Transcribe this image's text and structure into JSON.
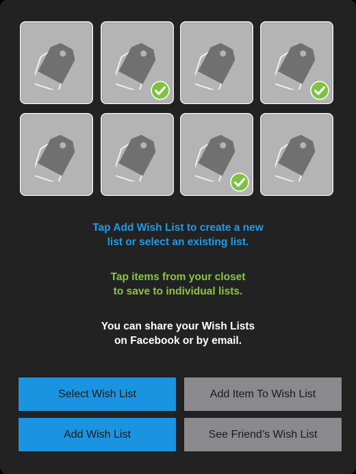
{
  "grid": {
    "tiles": [
      {
        "icon": "tag-icon",
        "checked": false
      },
      {
        "icon": "tag-icon",
        "checked": true
      },
      {
        "icon": "tag-icon",
        "checked": false
      },
      {
        "icon": "tag-icon",
        "checked": true
      },
      {
        "icon": "tag-icon",
        "checked": false
      },
      {
        "icon": "tag-icon",
        "checked": false
      },
      {
        "icon": "tag-icon",
        "checked": true
      },
      {
        "icon": "tag-icon",
        "checked": false
      }
    ]
  },
  "messages": {
    "add_list": "Tap Add Wish List to create a new\nlist or select an existing list.",
    "save_items": "Tap items from your closet\nto save to individual lists.",
    "share": "You can share your Wish Lists\non Facebook or by email."
  },
  "buttons": {
    "select_wish_list": "Select Wish List",
    "add_item_to_wish_list": "Add Item To Wish List",
    "add_wish_list": "Add Wish List",
    "see_friends_wish_list": "See Friend’s Wish List"
  },
  "colors": {
    "background": "#222222",
    "tile": "#b4b4b4",
    "tile_border": "#e2e2e2",
    "blue_text": "#1f9be8",
    "green_text": "#8bc53f",
    "check_green": "#7dc242",
    "blue_button": "#1a94e0",
    "gray_button": "#8a8a8e"
  }
}
